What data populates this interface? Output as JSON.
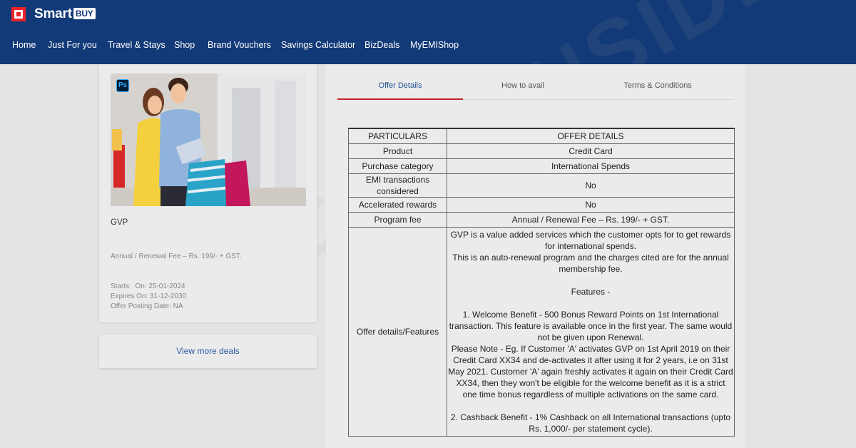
{
  "header": {
    "logo_text": "Smart",
    "logo_buy": "BUY",
    "nav": [
      {
        "label": "Home"
      },
      {
        "label": "Just For you"
      },
      {
        "label": "Travel & Stays"
      },
      {
        "label": "Shop"
      },
      {
        "label": "Brand Vouchers"
      },
      {
        "label": "Savings Calculator"
      },
      {
        "label": "BizDeals"
      },
      {
        "label": "MyEMIShop"
      }
    ]
  },
  "offer_card": {
    "image_badge": "Ps",
    "title": "GVP",
    "fee": "Annual / Renewal Fee – Rs. 199/- + GST.",
    "starts": "Starts   On: 25-01-2024",
    "expires": "Expires On: 31-12-2030",
    "posting": "Offer Posting Date: NA"
  },
  "view_more": "View more deals",
  "tabs": [
    {
      "label": "Offer Details",
      "active": true
    },
    {
      "label": "How to avail",
      "active": false
    },
    {
      "label": "Terms & Conditions",
      "active": false
    }
  ],
  "table": {
    "headers": [
      "PARTICULARS",
      "OFFER DETAILS"
    ],
    "rows": [
      {
        "label": "Product",
        "value": "Credit Card"
      },
      {
        "label": "Purchase category",
        "value": "International Spends"
      },
      {
        "label": "EMI transactions considered",
        "value": "No"
      },
      {
        "label": "Accelerated rewards",
        "value": "No"
      },
      {
        "label": "Program fee",
        "value": "Annual / Renewal Fee – Rs. 199/- + GST."
      },
      {
        "label": "Offer details/Features",
        "value": "GVP is a value added services which the customer opts for to get rewards for international spends.\nThis is an auto-renewal program and the charges cited are for the annual membership fee.\n\nFeatures -\n\n1. Welcome Benefit - 500 Bonus Reward Points on 1st International transaction. This feature is available once in the first year. The same would not be given upon Renewal.\nPlease Note - Eg. If Customer 'A' activates GVP on 1st April 2019 on their Credit Card XX34 and de-activates it after using it for 2 years, i.e on 31st May 2021. Customer 'A' again freshly activates it again on their Credit Card XX34, then they won't be eligible for the welcome benefit as it is a strict one time bonus regardless of multiple activations on the same card.\n\n2. Cashback Benefit - 1% Cashback on all International transactions (upto Rs. 1,000/- per statement cycle)."
      }
    ]
  },
  "watermark": "CARDINSIDER",
  "colors": {
    "header_bg": "#133a78",
    "accent_red": "#c02028",
    "link_blue": "#2857a4"
  }
}
